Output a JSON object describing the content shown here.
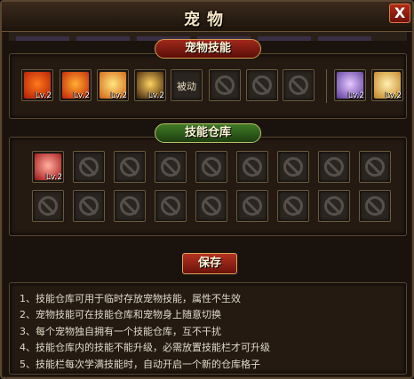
{
  "window": {
    "title": "宠物",
    "close_label": "X"
  },
  "pet_skills": {
    "title": "宠物技能",
    "slots": [
      {
        "type": "skill",
        "icon": "fire-ring-icon",
        "level": "Lv.2",
        "colors": [
          "#ff7a1a",
          "#b01a08"
        ]
      },
      {
        "type": "skill",
        "icon": "flame-slash-icon",
        "level": "Lv.2",
        "colors": [
          "#ffb030",
          "#c02008"
        ]
      },
      {
        "type": "skill",
        "icon": "fire-pillar-icon",
        "level": "Lv.2",
        "colors": [
          "#ffe680",
          "#d06010"
        ]
      },
      {
        "type": "skill",
        "icon": "golden-burst-icon",
        "level": "Lv.2",
        "colors": [
          "#ffd060",
          "#3a2008"
        ]
      },
      {
        "type": "passive",
        "label": "被动"
      },
      {
        "type": "locked"
      },
      {
        "type": "locked"
      },
      {
        "type": "locked"
      },
      {
        "type": "skill",
        "icon": "spirit-figure-icon",
        "level": "Lv.2",
        "colors": [
          "#e6c8ff",
          "#5a3a9a"
        ]
      },
      {
        "type": "skill",
        "icon": "golden-aura-icon",
        "level": "Lv.2",
        "colors": [
          "#fff0b0",
          "#c08020"
        ]
      }
    ]
  },
  "skill_storage": {
    "title": "技能仓库",
    "first_skill": {
      "icon": "burning-hand-icon",
      "level": "Lv.2",
      "colors": [
        "#ffb0a0",
        "#a01010"
      ]
    },
    "locked_count": 19
  },
  "save_label": "保存",
  "notes": [
    "1、技能仓库可用于临时存放宠物技能，属性不生效",
    "2、宠物技能可在技能仓库和宠物身上随意切换",
    "3、每个宠物独自拥有一个技能仓库，互不干扰",
    "4、技能仓库内的技能不能升级，必需放置技能栏才可升级",
    "5、技能栏每次学满技能时，自动开启一个新的仓库格子"
  ]
}
